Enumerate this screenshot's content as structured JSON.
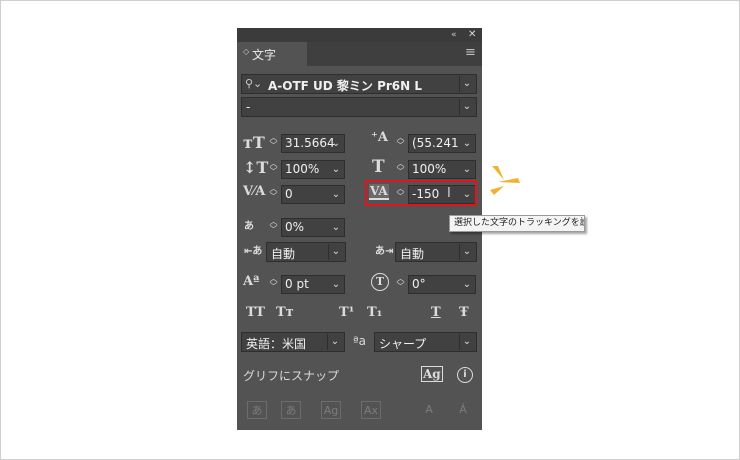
{
  "panel": {
    "tab_label": "文字",
    "collapse_icon": "«",
    "close_icon": "✕",
    "menu_icon": "≡"
  },
  "font": {
    "family": "A-OTF UD 黎ミン Pr6N L",
    "style": "-"
  },
  "fields": {
    "font_size": "31.5664",
    "leading": "(55.241",
    "vertical_scale": "100%",
    "horizontal_scale": "100%",
    "kerning": "0",
    "tracking": "-150",
    "tsume": "0%",
    "aki_left": "自動",
    "aki_right": "自動",
    "baseline_shift": "0 pt",
    "rotation": "0°"
  },
  "buttons": {
    "all_caps": "TT",
    "small_caps": "Tт",
    "superscript": "T¹",
    "subscript": "T₁",
    "underline": "T",
    "strikethrough": "Ŧ"
  },
  "language": "英語：米国",
  "antialias_icon_label": "ªa",
  "antialias": "シャープ",
  "snap_label": "グリフにスナップ",
  "tooltip": "選択した文字のトラッキングを設定",
  "colors": {
    "panel_bg": "#535353",
    "highlight": "#e0141a",
    "burst": "#f0b42c"
  }
}
